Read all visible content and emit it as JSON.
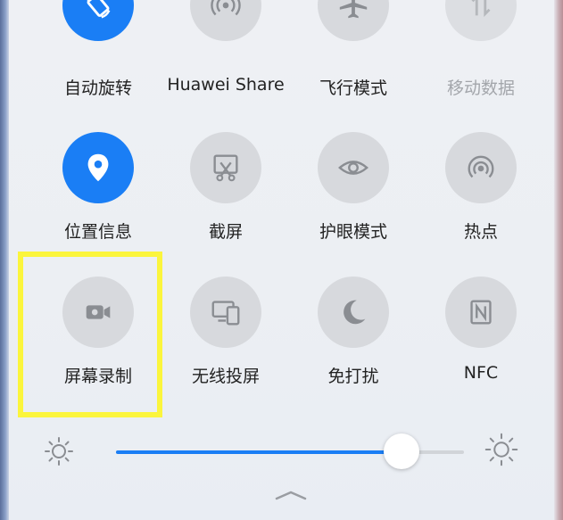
{
  "colors": {
    "active": "#1a7ef5",
    "inactive": "#d7d9dd",
    "highlight": "#fbf53c"
  },
  "tiles": [
    {
      "label": "自动旋转",
      "icon": "auto-rotate-icon",
      "active": true
    },
    {
      "label": "Huawei Share",
      "icon": "huawei-share-icon",
      "active": false
    },
    {
      "label": "飞行模式",
      "icon": "airplane-icon",
      "active": false
    },
    {
      "label": "移动数据",
      "icon": "mobile-data-icon",
      "active": false,
      "disabled": true
    },
    {
      "label": "位置信息",
      "icon": "location-icon",
      "active": true
    },
    {
      "label": "截屏",
      "icon": "screenshot-icon",
      "active": false
    },
    {
      "label": "护眼模式",
      "icon": "eye-icon",
      "active": false
    },
    {
      "label": "热点",
      "icon": "hotspot-icon",
      "active": false
    },
    {
      "label": "屏幕录制",
      "icon": "screen-record-icon",
      "active": false
    },
    {
      "label": "无线投屏",
      "icon": "wireless-projection-icon",
      "active": false
    },
    {
      "label": "免打扰",
      "icon": "moon-icon",
      "active": false
    },
    {
      "label": "NFC",
      "icon": "nfc-icon",
      "active": false
    }
  ],
  "brightness": {
    "level": 0.82,
    "min_icon": "sun-small-icon",
    "max_icon": "sun-large-icon"
  },
  "expand_handle_icon": "chevron-up-icon"
}
